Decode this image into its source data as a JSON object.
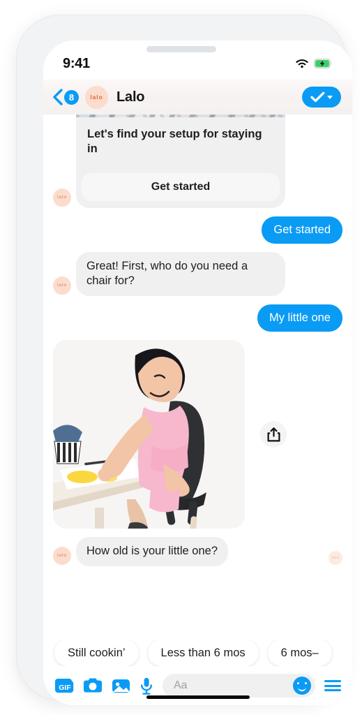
{
  "status_bar": {
    "time": "9:41",
    "wifi_icon": "wifi-icon",
    "battery_icon": "battery-charging-icon"
  },
  "header": {
    "back_icon": "chevron-left-icon",
    "unread_count": "8",
    "avatar_text": "lalo",
    "title": "Lalo",
    "action_icon": "checkmark-icon",
    "action_caret_icon": "caret-down-icon"
  },
  "thread": {
    "card": {
      "avatar_text": "lalo",
      "title": "Let's find your setup for staying in",
      "button_label": "Get started"
    },
    "messages": [
      {
        "id": "m1",
        "side": "out",
        "text": "Get started"
      },
      {
        "id": "m2",
        "side": "in",
        "avatar_text": "lalo",
        "text": "Great! First, who do you need a chair for?"
      },
      {
        "id": "m3",
        "side": "out",
        "text": "My little one"
      },
      {
        "id": "m4",
        "side": "in",
        "avatar_text": "lalo",
        "text": "How old is your little one?"
      }
    ],
    "photo": {
      "alt": "toddler seated in black high chair drawing at a table",
      "share_icon": "share-icon"
    },
    "seen_avatar_text": "lalo"
  },
  "quick_replies": [
    {
      "label": "Still cookin’"
    },
    {
      "label": "Less than 6 mos"
    },
    {
      "label": "6 mos–"
    }
  ],
  "composer": {
    "gif_label": "GIF",
    "gif_icon": "gif-icon",
    "camera_icon": "camera-icon",
    "gallery_icon": "image-icon",
    "mic_icon": "microphone-icon",
    "input_placeholder": "Aa",
    "input_value": "",
    "emoji_icon": "smiley-icon",
    "menu_icon": "hamburger-menu-icon"
  },
  "colors": {
    "accent_blue": "#0A9BF5",
    "bubble_gray": "#F0F0F0",
    "avatar_peach": "#FBDCCD",
    "brand_orange": "#E2673F"
  }
}
